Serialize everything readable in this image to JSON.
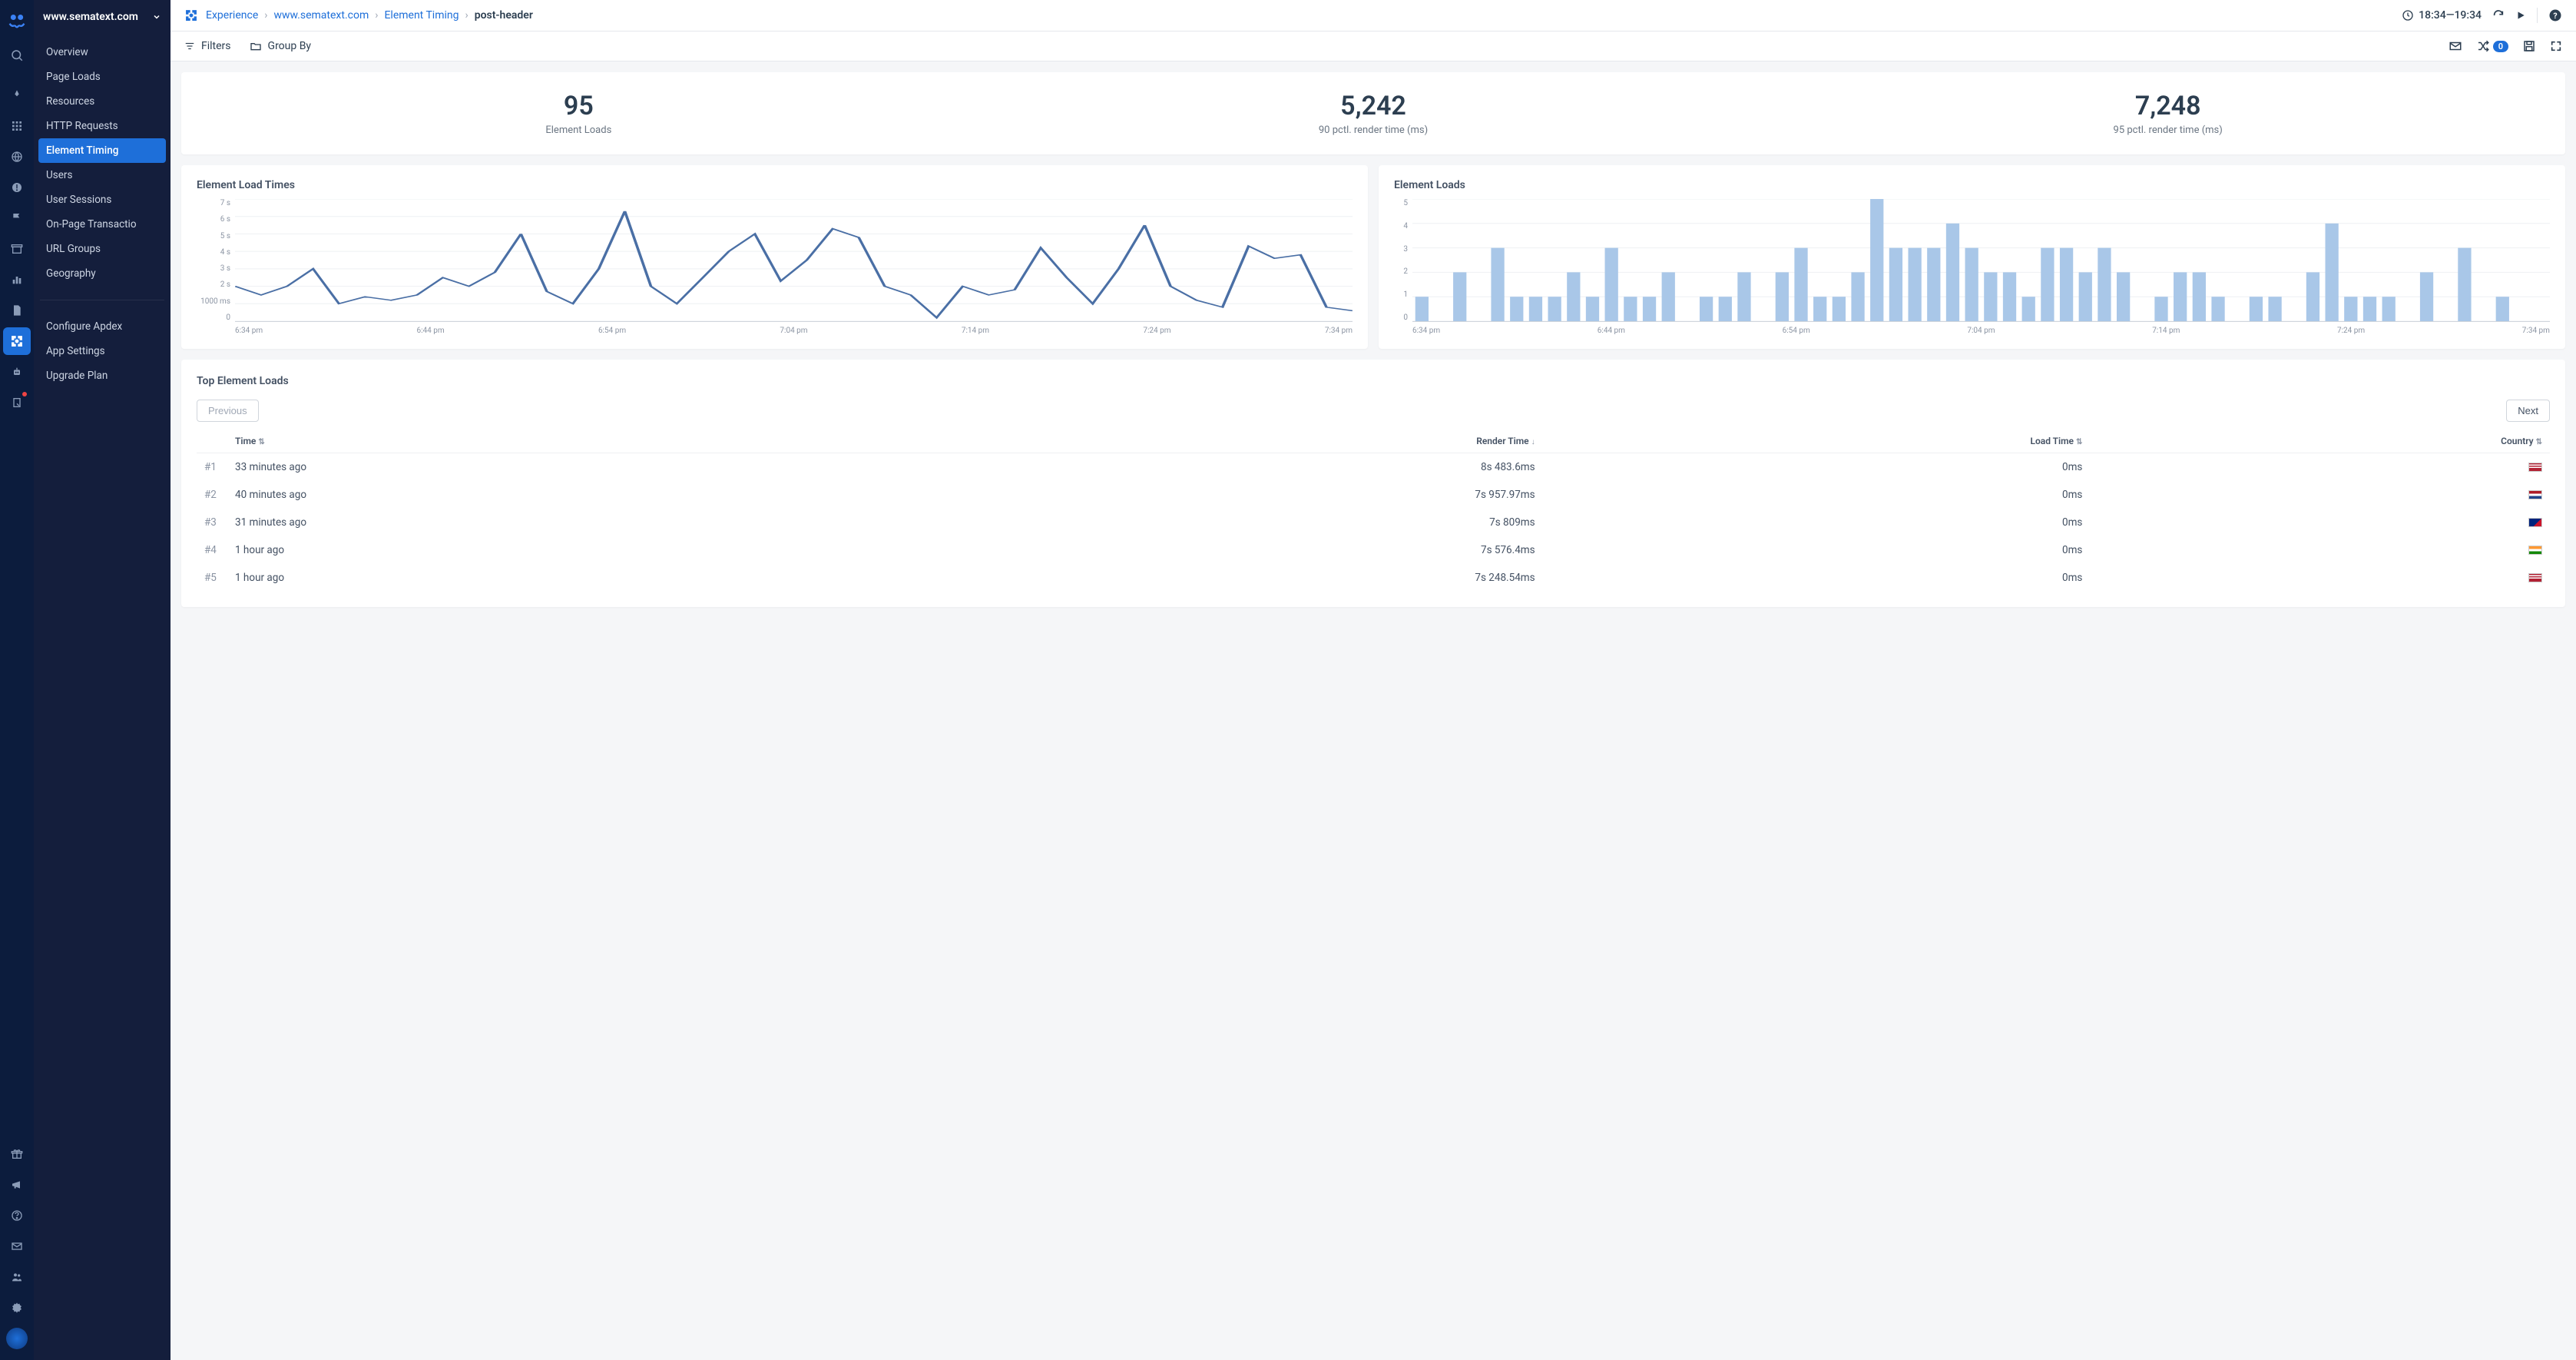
{
  "site_name": "www.sematext.com",
  "icon_rail": [
    {
      "name": "search-icon"
    },
    {
      "name": "rocket-icon"
    },
    {
      "name": "apps-grid-icon"
    },
    {
      "name": "globe-icon"
    },
    {
      "name": "alert-icon"
    },
    {
      "name": "flag-icon"
    },
    {
      "name": "archive-icon"
    },
    {
      "name": "chart-icon"
    },
    {
      "name": "file-icon"
    },
    {
      "name": "target-icon",
      "active": true
    },
    {
      "name": "robot-icon"
    },
    {
      "name": "clipboard-icon",
      "dot": true
    }
  ],
  "icon_rail_bottom": [
    {
      "name": "gift-icon"
    },
    {
      "name": "megaphone-icon"
    },
    {
      "name": "help-icon"
    },
    {
      "name": "mail-icon"
    },
    {
      "name": "users-icon"
    },
    {
      "name": "settings-icon"
    },
    {
      "name": "world-icon"
    }
  ],
  "sidebar": {
    "items": [
      {
        "label": "Overview"
      },
      {
        "label": "Page Loads"
      },
      {
        "label": "Resources"
      },
      {
        "label": "HTTP Requests"
      },
      {
        "label": "Element Timing",
        "active": true
      },
      {
        "label": "Users"
      },
      {
        "label": "User Sessions"
      },
      {
        "label": "On-Page Transactio"
      },
      {
        "label": "URL Groups"
      },
      {
        "label": "Geography"
      }
    ],
    "items2": [
      {
        "label": "Configure Apdex"
      },
      {
        "label": "App Settings"
      },
      {
        "label": "Upgrade Plan"
      }
    ]
  },
  "breadcrumb": [
    {
      "label": "Experience",
      "link": true
    },
    {
      "label": "www.sematext.com",
      "link": true
    },
    {
      "label": "Element Timing",
      "link": true
    },
    {
      "label": "post-header",
      "current": true
    }
  ],
  "time_range": "18:34—19:34",
  "filterbar": {
    "filters": "Filters",
    "group_by": "Group By",
    "badge": "0"
  },
  "kpis": [
    {
      "value": "95",
      "label": "Element Loads"
    },
    {
      "value": "5,242",
      "label": "90 pctl. render time (ms)"
    },
    {
      "value": "7,248",
      "label": "95 pctl. render time (ms)"
    }
  ],
  "chart_data": [
    {
      "type": "line",
      "title": "Element Load Times",
      "ylabel": "",
      "xlabel": "",
      "y_ticks": [
        "7 s",
        "6 s",
        "5 s",
        "4 s",
        "3 s",
        "2 s",
        "1000 ms",
        "0"
      ],
      "x_ticks": [
        "6:34 pm",
        "6:44 pm",
        "6:54 pm",
        "7:04 pm",
        "7:14 pm",
        "7:24 pm",
        "7:34 pm"
      ],
      "ylim": [
        0,
        7
      ],
      "values_seconds": [
        2.0,
        1.5,
        2.0,
        3.0,
        1.0,
        1.4,
        1.2,
        1.5,
        2.5,
        2.0,
        2.8,
        5.0,
        1.7,
        1.0,
        3.0,
        6.3,
        2.0,
        1.0,
        2.5,
        4.0,
        5.0,
        2.3,
        3.5,
        5.3,
        4.8,
        2.0,
        1.5,
        0.2,
        2.0,
        1.5,
        1.8,
        4.2,
        2.5,
        1.0,
        3.0,
        5.5,
        2.0,
        1.2,
        0.8,
        4.3,
        3.6,
        3.8,
        0.8,
        0.6
      ]
    },
    {
      "type": "bar",
      "title": "Element Loads",
      "ylabel": "",
      "xlabel": "",
      "y_ticks": [
        "5",
        "4",
        "3",
        "2",
        "1",
        "0"
      ],
      "x_ticks": [
        "6:34 pm",
        "6:44 pm",
        "6:54 pm",
        "7:04 pm",
        "7:14 pm",
        "7:24 pm",
        "7:34 pm"
      ],
      "ylim": [
        0,
        5
      ],
      "values": [
        1,
        0,
        2,
        0,
        3,
        1,
        1,
        1,
        2,
        1,
        3,
        1,
        1,
        2,
        0,
        1,
        1,
        2,
        0,
        2,
        3,
        1,
        1,
        2,
        5,
        3,
        3,
        3,
        4,
        3,
        2,
        2,
        1,
        3,
        3,
        2,
        3,
        2,
        0,
        1,
        2,
        2,
        1,
        0,
        1,
        1,
        0,
        2,
        4,
        1,
        1,
        1,
        0,
        2,
        0,
        3,
        0,
        1,
        0,
        0
      ]
    }
  ],
  "table": {
    "title": "Top Element Loads",
    "prev": "Previous",
    "next": "Next",
    "columns": [
      "Time",
      "Render Time",
      "Load Time",
      "Country"
    ],
    "sort_col": 1,
    "rows": [
      {
        "idx": "#1",
        "time": "33 minutes ago",
        "render": "8s 483.6ms",
        "load": "0ms",
        "flag": "us"
      },
      {
        "idx": "#2",
        "time": "40 minutes ago",
        "render": "7s 957.97ms",
        "load": "0ms",
        "flag": "nl"
      },
      {
        "idx": "#3",
        "time": "31 minutes ago",
        "render": "7s 809ms",
        "load": "0ms",
        "flag": "nz"
      },
      {
        "idx": "#4",
        "time": "1 hour ago",
        "render": "7s 576.4ms",
        "load": "0ms",
        "flag": "in"
      },
      {
        "idx": "#5",
        "time": "1 hour ago",
        "render": "7s 248.54ms",
        "load": "0ms",
        "flag": "us"
      }
    ]
  },
  "flag_colors": {
    "us": "linear-gradient(to bottom, #b22234 0%, #b22234 15%, #fff 15%, #fff 30%, #b22234 30%, #b22234 45%, #fff 45%, #fff 60%, #b22234 60%, #b22234 100%)",
    "nl": "linear-gradient(to bottom, #AE1C28 33%, #fff 33%, #fff 66%, #21468B 66%)",
    "nz": "linear-gradient(135deg, #00247D 60%, #CC142B 60%)",
    "in": "linear-gradient(to bottom, #FF9933 33%, #fff 33%, #fff 66%, #138808 66%)"
  }
}
